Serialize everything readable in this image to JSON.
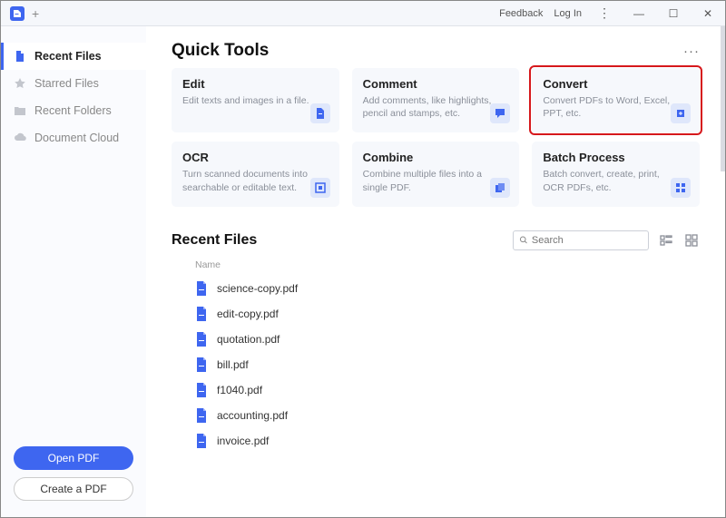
{
  "titlebar": {
    "feedback": "Feedback",
    "login": "Log In"
  },
  "sidebar": {
    "items": [
      {
        "label": "Recent Files"
      },
      {
        "label": "Starred Files"
      },
      {
        "label": "Recent Folders"
      },
      {
        "label": "Document Cloud"
      }
    ],
    "open_pdf": "Open PDF",
    "create_pdf": "Create a PDF"
  },
  "quick_tools": {
    "heading": "Quick Tools",
    "tools": [
      {
        "title": "Edit",
        "desc": "Edit texts and images in a file."
      },
      {
        "title": "Comment",
        "desc": "Add comments, like highlights, pencil and stamps, etc."
      },
      {
        "title": "Convert",
        "desc": "Convert PDFs to Word, Excel, PPT, etc."
      },
      {
        "title": "OCR",
        "desc": "Turn scanned documents into searchable or editable text."
      },
      {
        "title": "Combine",
        "desc": "Combine multiple files into a single PDF."
      },
      {
        "title": "Batch Process",
        "desc": "Batch convert, create, print, OCR PDFs, etc."
      }
    ]
  },
  "recent": {
    "heading": "Recent Files",
    "search_placeholder": "Search",
    "col_name": "Name",
    "files": [
      {
        "name": "science-copy.pdf"
      },
      {
        "name": "edit-copy.pdf"
      },
      {
        "name": "quotation.pdf"
      },
      {
        "name": "bill.pdf"
      },
      {
        "name": "f1040.pdf"
      },
      {
        "name": "accounting.pdf"
      },
      {
        "name": "invoice.pdf"
      }
    ]
  }
}
